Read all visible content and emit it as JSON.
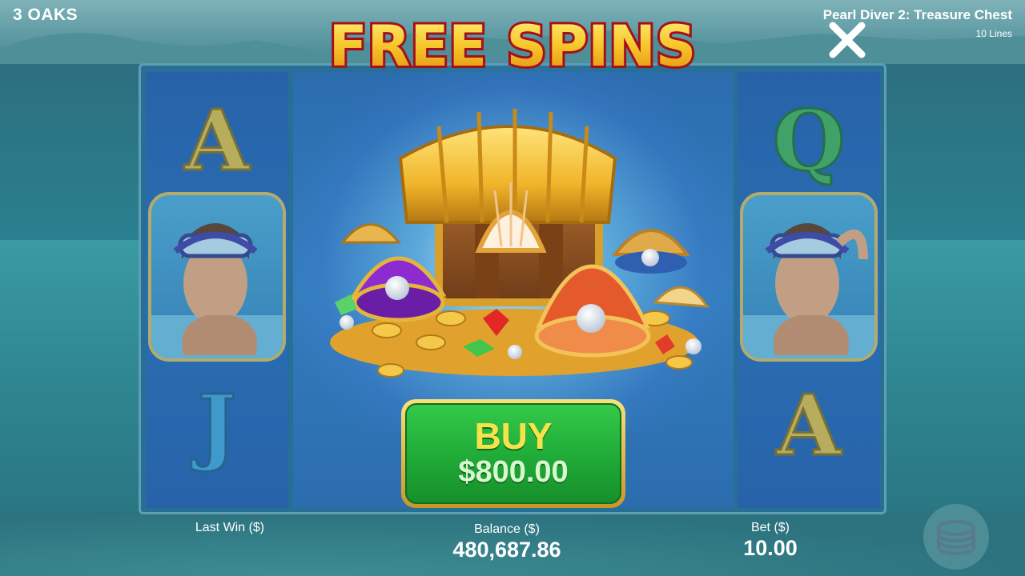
{
  "brand": "3 OAKS",
  "game": {
    "title": "Pearl Diver 2: Treasure Chest",
    "lines": "10 Lines"
  },
  "banner": {
    "title": "FREE SPINS"
  },
  "reels": {
    "left_symbols": [
      "A",
      "diver",
      "J"
    ],
    "right_symbols": [
      "Q",
      "diver",
      "A"
    ]
  },
  "buy": {
    "label": "BUY",
    "price": "$800.00"
  },
  "stats": {
    "last_win_label": "Last Win ($)",
    "balance_label": "Balance ($)",
    "balance_value": "480,687.86",
    "bet_label": "Bet ($)",
    "bet_value": "10.00"
  },
  "icons": {
    "close": "close-icon",
    "coins": "coin-stack-icon"
  },
  "colors": {
    "buy_green": "#22b03a",
    "banner_gold": "#f7c52a",
    "banner_red": "#b3141a"
  }
}
